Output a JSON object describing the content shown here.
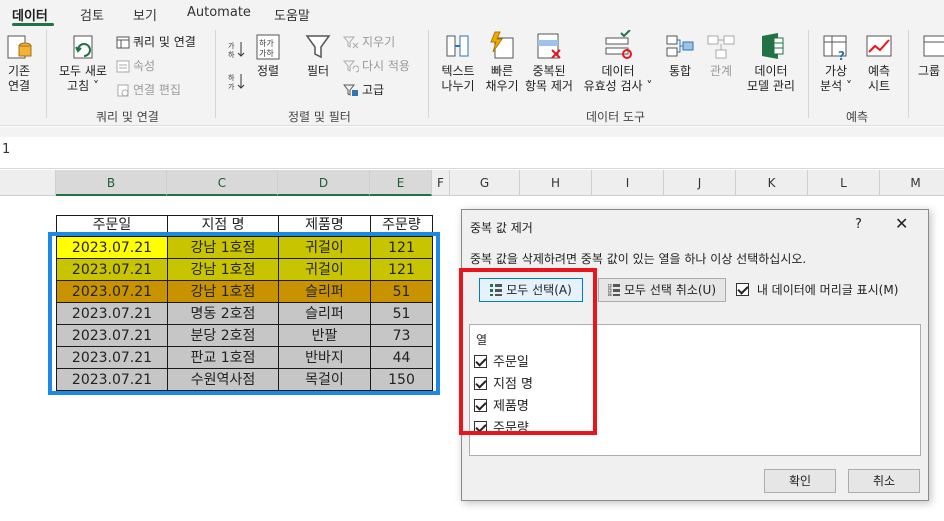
{
  "tabs": [
    {
      "label": "데이터",
      "active": true
    },
    {
      "label": "검토"
    },
    {
      "label": "보기"
    },
    {
      "label": "Automate"
    },
    {
      "label": "도움말"
    }
  ],
  "ribbon": {
    "get_data": {
      "line1": "기존",
      "line2": "연결"
    },
    "refresh_all": {
      "line1": "모두 새로",
      "line2": "고침 ˅"
    },
    "queries_connections": "쿼리 및 연결",
    "properties": "속성",
    "edit_links": "연결 편집",
    "group_queries": "쿼리 및 연결",
    "sort": "정렬",
    "filter": "필터",
    "clear": "지우기",
    "reapply": "다시 적용",
    "advanced": "고급",
    "group_sort_filter": "정렬 및 필터",
    "text_to_columns": {
      "line1": "텍스트",
      "line2": "나누기"
    },
    "flash_fill": {
      "line1": "빠른",
      "line2": "채우기"
    },
    "remove_duplicates": {
      "line1": "중복된",
      "line2": "항목 제거"
    },
    "data_validation": {
      "line1": "데이터",
      "line2": "유효성 검사 ˅"
    },
    "consolidate": "통합",
    "relationships": "관계",
    "data_model": {
      "line1": "데이터",
      "line2": "모델 관리"
    },
    "group_data_tools": "데이터 도구",
    "what_if": {
      "line1": "가상",
      "line2": "분석 ˅"
    },
    "forecast_sheet": {
      "line1": "예측",
      "line2": "시트"
    },
    "group_forecast": "예측",
    "outline": {
      "line1": "그룹",
      "line2": ""
    }
  },
  "formula_bar": {
    "text": "1"
  },
  "columns": [
    "B",
    "C",
    "D",
    "E",
    "F",
    "G",
    "H",
    "I",
    "J",
    "K",
    "L",
    "M"
  ],
  "table": {
    "headers": [
      "주문일",
      "지점 명",
      "제품명",
      "주문량"
    ],
    "rows": [
      [
        "2023.07.21",
        "강남 1호점",
        "귀걸이",
        "121"
      ],
      [
        "2023.07.21",
        "강남 1호점",
        "귀걸이",
        "121"
      ],
      [
        "2023.07.21",
        "강남 1호점",
        "슬리퍼",
        "51"
      ],
      [
        "2023.07.21",
        "명동 2호점",
        "슬리퍼",
        "51"
      ],
      [
        "2023.07.21",
        "분당 2호점",
        "반팔",
        "73"
      ],
      [
        "2023.07.21",
        "판교 1호점",
        "반바지",
        "44"
      ],
      [
        "2023.07.21",
        "수원역사점",
        "목걸이",
        "150"
      ]
    ]
  },
  "dialog": {
    "title": "중복 값 제거",
    "help": "?",
    "close": "✕",
    "instruction": "중복 값을 삭제하려면 중복 값이 있는 열을 하나 이상 선택하십시오.",
    "select_all": "모두 선택(A)",
    "unselect_all": "모두 선택 취소(U)",
    "has_headers": "내 데이터에 머리글 표시(M)",
    "columns_label": "열",
    "columns": [
      "주문일",
      "지점 명",
      "제품명",
      "주문량"
    ],
    "ok": "확인",
    "cancel": "취소"
  },
  "colors": {
    "excel_green": "#217346",
    "highlight_yellow": "#ffff00",
    "highlight_olive": "#c9c400",
    "highlight_amber": "#c99300",
    "highlight_gray": "#c6c6c6",
    "selection_blue": "#1e88e5",
    "annotation_red": "#e8141e"
  }
}
